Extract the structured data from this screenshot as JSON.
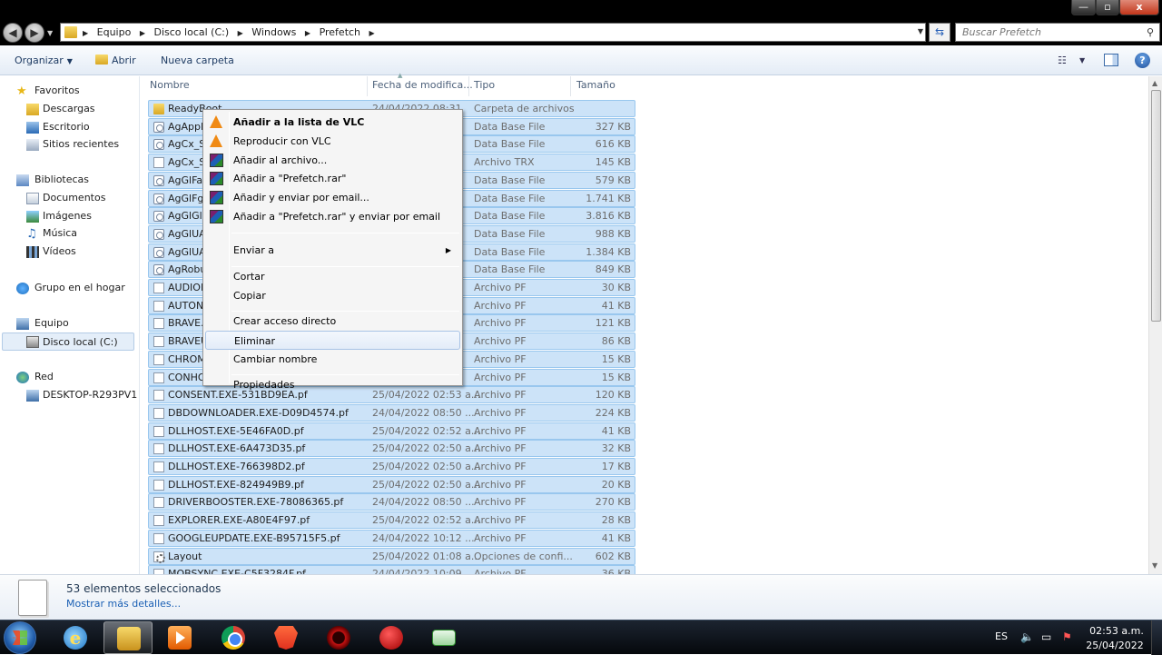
{
  "window": {
    "min_label": "—",
    "max_label": "▫",
    "close_label": "x"
  },
  "address": {
    "crumbs": [
      "Equipo",
      "Disco local (C:)",
      "Windows",
      "Prefetch"
    ],
    "search_placeholder": "Buscar Prefetch"
  },
  "toolbar": {
    "organize": "Organizar",
    "open": "Abrir",
    "new_folder": "Nueva carpeta"
  },
  "nav": [
    {
      "label": "Favoritos",
      "icon": "star-icon"
    },
    {
      "label": "Descargas",
      "icon": "downloads-folder-icon"
    },
    {
      "label": "Escritorio",
      "icon": "desktop-icon"
    },
    {
      "label": "Sitios recientes",
      "icon": "recent-places-icon"
    },
    {
      "label": "Bibliotecas",
      "icon": "libraries-icon"
    },
    {
      "label": "Documentos",
      "icon": "documents-icon"
    },
    {
      "label": "Imágenes",
      "icon": "pictures-icon"
    },
    {
      "label": "Música",
      "icon": "music-icon"
    },
    {
      "label": "Vídeos",
      "icon": "videos-icon"
    },
    {
      "label": "Grupo en el hogar",
      "icon": "homegroup-icon"
    },
    {
      "label": "Equipo",
      "icon": "computer-icon"
    },
    {
      "label": "Disco local (C:)",
      "icon": "drive-icon"
    },
    {
      "label": "Red",
      "icon": "network-icon"
    },
    {
      "label": "DESKTOP-R293PV1",
      "icon": "network-computer-icon"
    }
  ],
  "columns": {
    "name": "Nombre",
    "date": "Fecha de modifica...",
    "type": "Tipo",
    "size": "Tamaño"
  },
  "files": [
    {
      "name": "ReadyBoot",
      "date": "24/04/2022 08:31",
      "type": "Carpeta de archivos",
      "size": "",
      "icon": "folder"
    },
    {
      "name": "AgAppLaunch.db",
      "date": "",
      "type": "Data Base File",
      "size": "327 KB",
      "icon": "db"
    },
    {
      "name": "AgCx_SC",
      "date": "",
      "type": "Data Base File",
      "size": "616 KB",
      "icon": "db"
    },
    {
      "name": "AgCx_SC",
      "date": "",
      "type": "Archivo TRX",
      "size": "145 KB",
      "icon": "file"
    },
    {
      "name": "AgGlFau",
      "date": "",
      "type": "Data Base File",
      "size": "579 KB",
      "icon": "db"
    },
    {
      "name": "AgGlFga",
      "date": "",
      "type": "Data Base File",
      "size": "1.741 KB",
      "icon": "db"
    },
    {
      "name": "AgGlGlo",
      "date": "",
      "type": "Data Base File",
      "size": "3.816 KB",
      "icon": "db"
    },
    {
      "name": "AgGlUA",
      "date": "",
      "type": "Data Base File",
      "size": "988 KB",
      "icon": "db"
    },
    {
      "name": "AgGlUA",
      "date": "",
      "type": "Data Base File",
      "size": "1.384 KB",
      "icon": "db"
    },
    {
      "name": "AgRobu",
      "date": "",
      "type": "Data Base File",
      "size": "849 KB",
      "icon": "db"
    },
    {
      "name": "AUDIOD",
      "date": "",
      "type": "Archivo PF",
      "size": "30 KB",
      "icon": "file"
    },
    {
      "name": "AUTON",
      "date": "",
      "type": "Archivo PF",
      "size": "41 KB",
      "icon": "file"
    },
    {
      "name": "BRAVE.E",
      "date": "",
      "type": "Archivo PF",
      "size": "121 KB",
      "icon": "file"
    },
    {
      "name": "BRAVEU",
      "date": "",
      "type": "Archivo PF",
      "size": "86 KB",
      "icon": "file"
    },
    {
      "name": "CHROM",
      "date": "",
      "type": "Archivo PF",
      "size": "15 KB",
      "icon": "file"
    },
    {
      "name": "CONHO",
      "date": "",
      "type": "Archivo PF",
      "size": "15 KB",
      "icon": "file"
    },
    {
      "name": "CONSENT.EXE-531BD9EA.pf",
      "date": "25/04/2022 02:53 a...",
      "type": "Archivo PF",
      "size": "120 KB",
      "icon": "file"
    },
    {
      "name": "DBDOWNLOADER.EXE-D09D4574.pf",
      "date": "24/04/2022 08:50 ...",
      "type": "Archivo PF",
      "size": "224 KB",
      "icon": "file"
    },
    {
      "name": "DLLHOST.EXE-5E46FA0D.pf",
      "date": "25/04/2022 02:52 a...",
      "type": "Archivo PF",
      "size": "41 KB",
      "icon": "file"
    },
    {
      "name": "DLLHOST.EXE-6A473D35.pf",
      "date": "25/04/2022 02:50 a...",
      "type": "Archivo PF",
      "size": "32 KB",
      "icon": "file"
    },
    {
      "name": "DLLHOST.EXE-766398D2.pf",
      "date": "25/04/2022 02:50 a...",
      "type": "Archivo PF",
      "size": "17 KB",
      "icon": "file"
    },
    {
      "name": "DLLHOST.EXE-824949B9.pf",
      "date": "25/04/2022 02:50 a...",
      "type": "Archivo PF",
      "size": "20 KB",
      "icon": "file"
    },
    {
      "name": "DRIVERBOOSTER.EXE-78086365.pf",
      "date": "24/04/2022 08:50 ...",
      "type": "Archivo PF",
      "size": "270 KB",
      "icon": "file"
    },
    {
      "name": "EXPLORER.EXE-A80E4F97.pf",
      "date": "25/04/2022 02:52 a...",
      "type": "Archivo PF",
      "size": "28 KB",
      "icon": "file"
    },
    {
      "name": "GOOGLEUPDATE.EXE-B95715F5.pf",
      "date": "24/04/2022 10:12 ...",
      "type": "Archivo PF",
      "size": "41 KB",
      "icon": "file"
    },
    {
      "name": "Layout",
      "date": "25/04/2022 01:08 a...",
      "type": "Opciones de confi...",
      "size": "602 KB",
      "icon": "cfg"
    },
    {
      "name": "MOBSYNC.EXE-C5F3284F.pf",
      "date": "24/04/2022 10:09 ...",
      "type": "Archivo PF",
      "size": "36 KB",
      "icon": "file"
    }
  ],
  "context_menu": {
    "items": [
      {
        "label": "Añadir a la lista de VLC",
        "icon": "vlc",
        "bold": true
      },
      {
        "label": "Reproducir con VLC",
        "icon": "vlc"
      },
      {
        "label": "Añadir al archivo...",
        "icon": "rar"
      },
      {
        "label": "Añadir a \"Prefetch.rar\"",
        "icon": "rar"
      },
      {
        "label": "Añadir y enviar por email...",
        "icon": "rar"
      },
      {
        "label": "Añadir a \"Prefetch.rar\" y enviar por email",
        "icon": "rar"
      },
      {
        "label": "Enviar a",
        "submenu": true
      },
      {
        "label": "Cortar"
      },
      {
        "label": "Copiar"
      },
      {
        "label": "Crear acceso directo"
      },
      {
        "label": "Eliminar",
        "highlighted": true
      },
      {
        "label": "Cambiar nombre"
      },
      {
        "label": "Propiedades"
      }
    ]
  },
  "details": {
    "count": "53 elementos seleccionados",
    "more": "Mostrar más detalles..."
  },
  "taskbar": {
    "lang": "ES",
    "time": "02:53 a.m.",
    "date": "25/04/2022",
    "apps": [
      "internet-explorer-icon",
      "file-explorer-icon",
      "media-player-icon",
      "chrome-icon",
      "brave-icon",
      "red-app-icon",
      "red-ball-icon",
      "green-app-icon"
    ]
  }
}
